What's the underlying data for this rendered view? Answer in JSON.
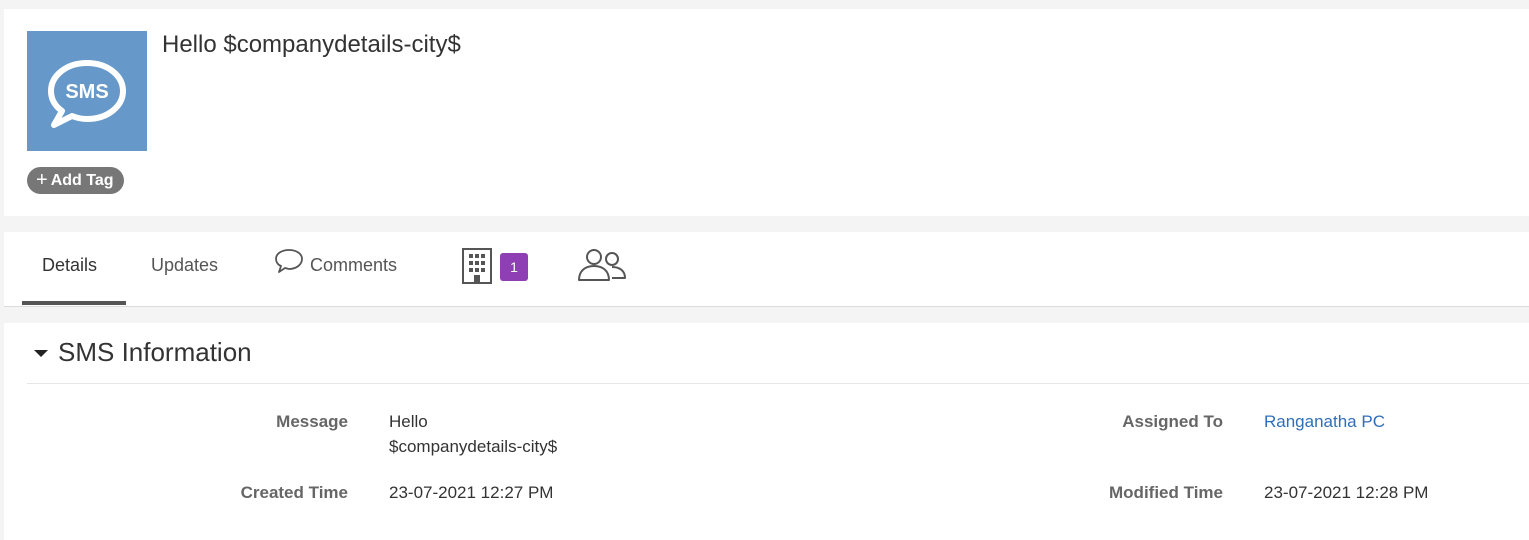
{
  "record": {
    "title": "Hello $companydetails-city$",
    "avatar_text": "SMS",
    "avatar_icon": "sms-speech-bubble-icon",
    "add_tag_plus": "+",
    "add_tag_label": "Add Tag"
  },
  "tabs": [
    {
      "label": "Details",
      "active": true
    },
    {
      "label": "Updates",
      "active": false
    },
    {
      "label": "Comments",
      "icon": "comment-bubble-icon",
      "active": false
    },
    {
      "icon": "building-icon",
      "badge": "1",
      "active": false
    },
    {
      "icon": "users-icon",
      "active": false
    }
  ],
  "section": {
    "title": "SMS Information",
    "fields": {
      "message": {
        "label": "Message",
        "value_line1": "Hello",
        "value_line2": "$companydetails-city$"
      },
      "assigned_to": {
        "label": "Assigned To",
        "value": "Ranganatha PC"
      },
      "created_time": {
        "label": "Created Time",
        "value": "23-07-2021 12:27 PM"
      },
      "modified_time": {
        "label": "Modified Time",
        "value": "23-07-2021 12:28 PM"
      }
    }
  },
  "colors": {
    "avatar_bg": "#6699c9",
    "tag_bg": "#777777",
    "badge_bg": "#8e3fb4",
    "link": "#2f6fb8"
  }
}
